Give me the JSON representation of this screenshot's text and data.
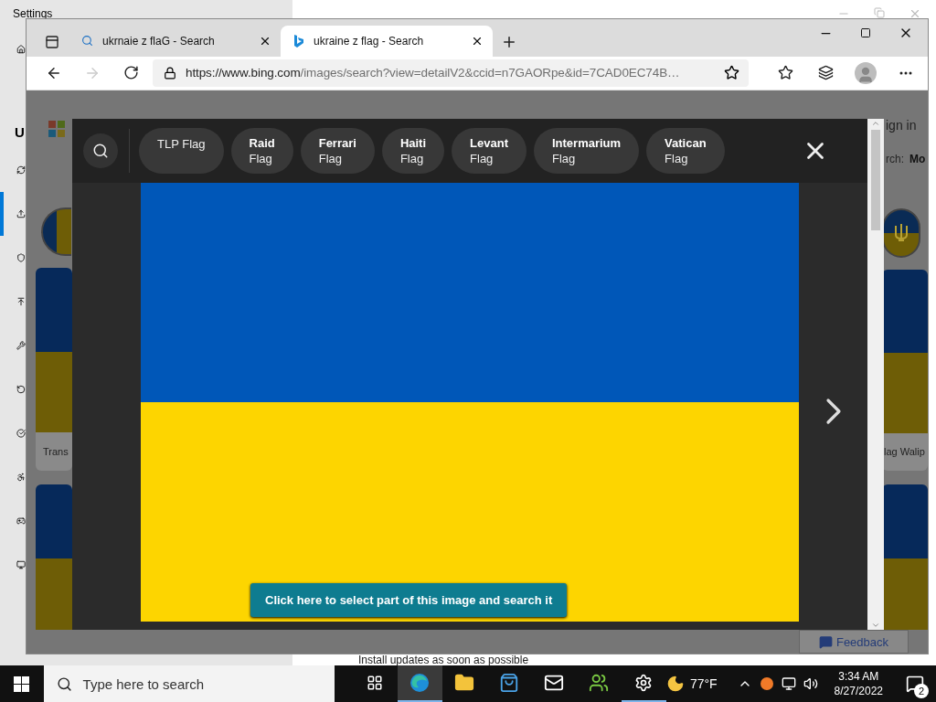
{
  "settings_window": {
    "title": "Settings",
    "heading": "U",
    "footer": "Install updates as soon as possible",
    "nav": [
      {
        "selected": false
      },
      {
        "selected": true
      },
      {
        "selected": false
      },
      {
        "selected": false
      },
      {
        "selected": false
      },
      {
        "selected": false
      },
      {
        "selected": false
      },
      {
        "selected": false
      },
      {
        "selected": false
      },
      {
        "selected": false
      }
    ]
  },
  "browser": {
    "tabs": [
      {
        "kind": "search",
        "title": "ukrnaie z flaG - Search",
        "selected": false
      },
      {
        "kind": "bing",
        "title": "ukraine z flag - Search",
        "selected": true
      }
    ],
    "url_host": "https://www.bing.com",
    "url_path": "/images/search?view=detailV2&ccid=n7GAORpe&id=7CAD0EC74B…",
    "forward_disabled": true
  },
  "page": {
    "sign_in": "ign in",
    "search_label": "rch:",
    "search_more": "Mo",
    "captions": [
      "Trans",
      "lag Walip"
    ],
    "feedback": "Feedback"
  },
  "viewer": {
    "chips": [
      {
        "kind": "single",
        "text": "TLP Flag"
      },
      {
        "kind": "double",
        "bold": "Raid",
        "text": "Flag"
      },
      {
        "kind": "double",
        "bold": "Ferrari",
        "text": "Flag"
      },
      {
        "kind": "double",
        "bold": "Haiti",
        "text": "Flag"
      },
      {
        "kind": "double",
        "bold": "Levant",
        "text": "Flag"
      },
      {
        "kind": "double",
        "bold": "Intermarium",
        "text": "Flag"
      },
      {
        "kind": "double",
        "bold": "Vatican",
        "text": "Flag"
      }
    ],
    "select_hint": "Click here to select part of this image and search it"
  },
  "taskbar": {
    "search_placeholder": "Type here to search",
    "apps": [
      {
        "kind": "taskview",
        "active": false,
        "running": false
      },
      {
        "kind": "edge",
        "active": true,
        "running": true
      },
      {
        "kind": "explorer",
        "active": false,
        "running": false
      },
      {
        "kind": "store",
        "active": false,
        "running": false
      },
      {
        "kind": "mail",
        "active": false,
        "running": false
      },
      {
        "kind": "people",
        "active": false,
        "running": false
      },
      {
        "kind": "settings",
        "active": false,
        "running": true
      }
    ],
    "weather": "77°F",
    "time": "3:34 AM",
    "date": "8/27/2022",
    "notifications": "2"
  }
}
